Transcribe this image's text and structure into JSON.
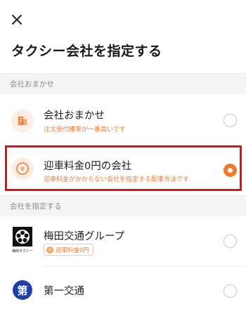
{
  "header": {
    "close_icon": "close-icon",
    "title": "タクシー会社を指定する"
  },
  "sections": [
    {
      "label": "会社おまかせ",
      "options": [
        {
          "icon": "building-icon",
          "title": "会社おまかせ",
          "subtitle": "注文受付確率が一番高いです",
          "selected": false
        },
        {
          "icon": "yen-coin-icon",
          "title": "迎車料金0円の会社",
          "subtitle": "迎車料金がかからない会社を指定する配車方法です",
          "selected": true
        }
      ]
    },
    {
      "label": "会社を指定する",
      "companies": [
        {
          "logo": "umeda-kotsu-logo",
          "logo_caption": "梅田タクシー",
          "name": "梅田交通グループ",
          "badge": "迎車料金0円",
          "badge_icon": "yen-coin-icon",
          "selected": false
        },
        {
          "logo": "daiichi-kotsu-logo",
          "logo_text": "第",
          "name": "第一交通",
          "selected": false
        }
      ]
    }
  ],
  "colors": {
    "accent": "#f07a2e",
    "highlight": "#e0101a",
    "logo_blue": "#1f3fa8"
  }
}
